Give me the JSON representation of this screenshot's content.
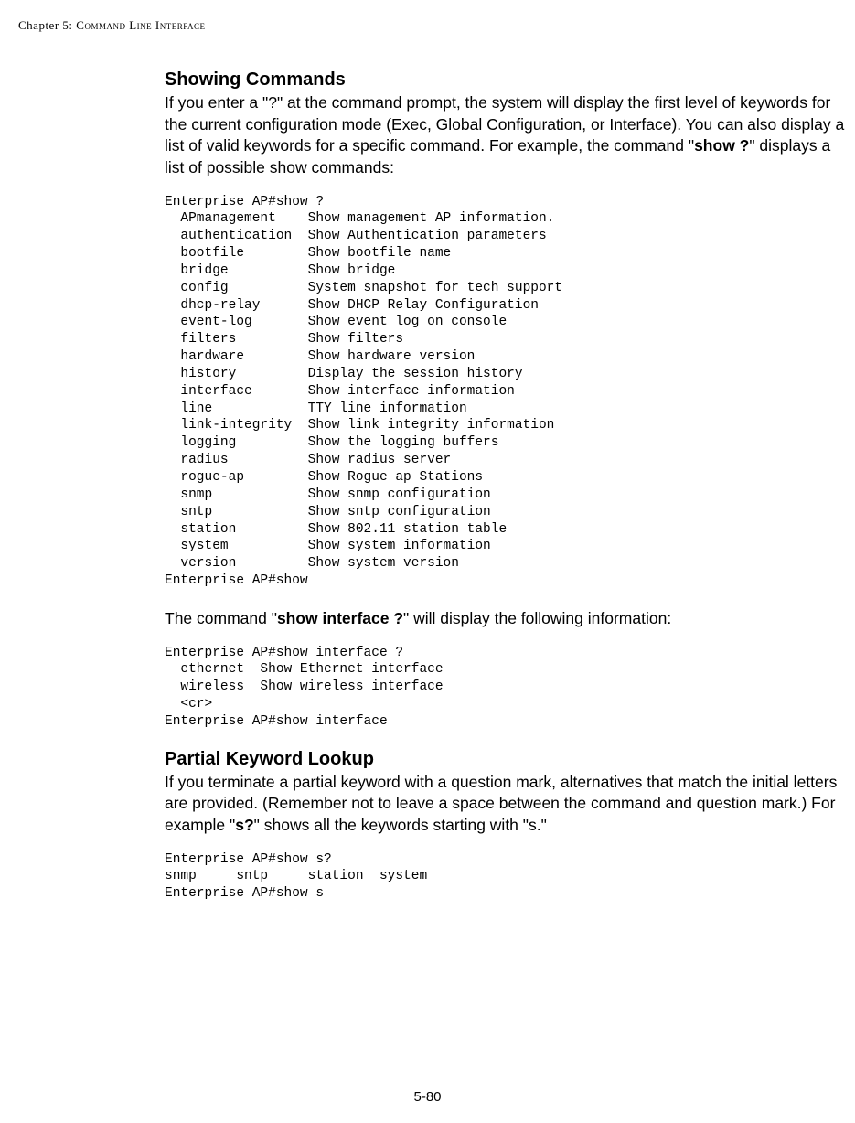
{
  "header": {
    "chapter_label": "Chapter",
    "chapter_number": "5:",
    "chapter_title": "Command Line Interface"
  },
  "section1": {
    "heading": "Showing Commands",
    "para_prefix": "If you enter a \"?\" at the command prompt, the system will display the first level of keywords for the current configuration mode (Exec, Global Configuration, or Interface). You can also display a list of valid keywords for a specific command. For example, the command \"",
    "para_bold": "show ?",
    "para_suffix": "\" displays a list of possible show commands:",
    "code1": "Enterprise AP#show ?\n  APmanagement    Show management AP information.\n  authentication  Show Authentication parameters\n  bootfile        Show bootfile name\n  bridge          Show bridge\n  config          System snapshot for tech support\n  dhcp-relay      Show DHCP Relay Configuration\n  event-log       Show event log on console\n  filters         Show filters\n  hardware        Show hardware version\n  history         Display the session history\n  interface       Show interface information\n  line            TTY line information\n  link-integrity  Show link integrity information\n  logging         Show the logging buffers\n  radius          Show radius server\n  rogue-ap        Show Rogue ap Stations\n  snmp            Show snmp configuration\n  sntp            Show sntp configuration\n  station         Show 802.11 station table\n  system          Show system information\n  version         Show system version\nEnterprise AP#show",
    "para2_prefix": "The command \"",
    "para2_bold": "show interface ?",
    "para2_suffix": "\" will display the following information:",
    "code2": "Enterprise AP#show interface ?\n  ethernet  Show Ethernet interface\n  wireless  Show wireless interface\n  <cr>\nEnterprise AP#show interface"
  },
  "section2": {
    "heading": "Partial Keyword Lookup",
    "para_prefix": "If you terminate a partial keyword with a question mark, alternatives that match the initial letters are provided. (Remember not to leave a space between the command and question mark.) For example \"",
    "para_bold": "s?",
    "para_suffix": "\" shows all the keywords starting with \"s.\"",
    "code": "Enterprise AP#show s?\nsnmp     sntp     station  system\nEnterprise AP#show s"
  },
  "page_number": "5-80"
}
